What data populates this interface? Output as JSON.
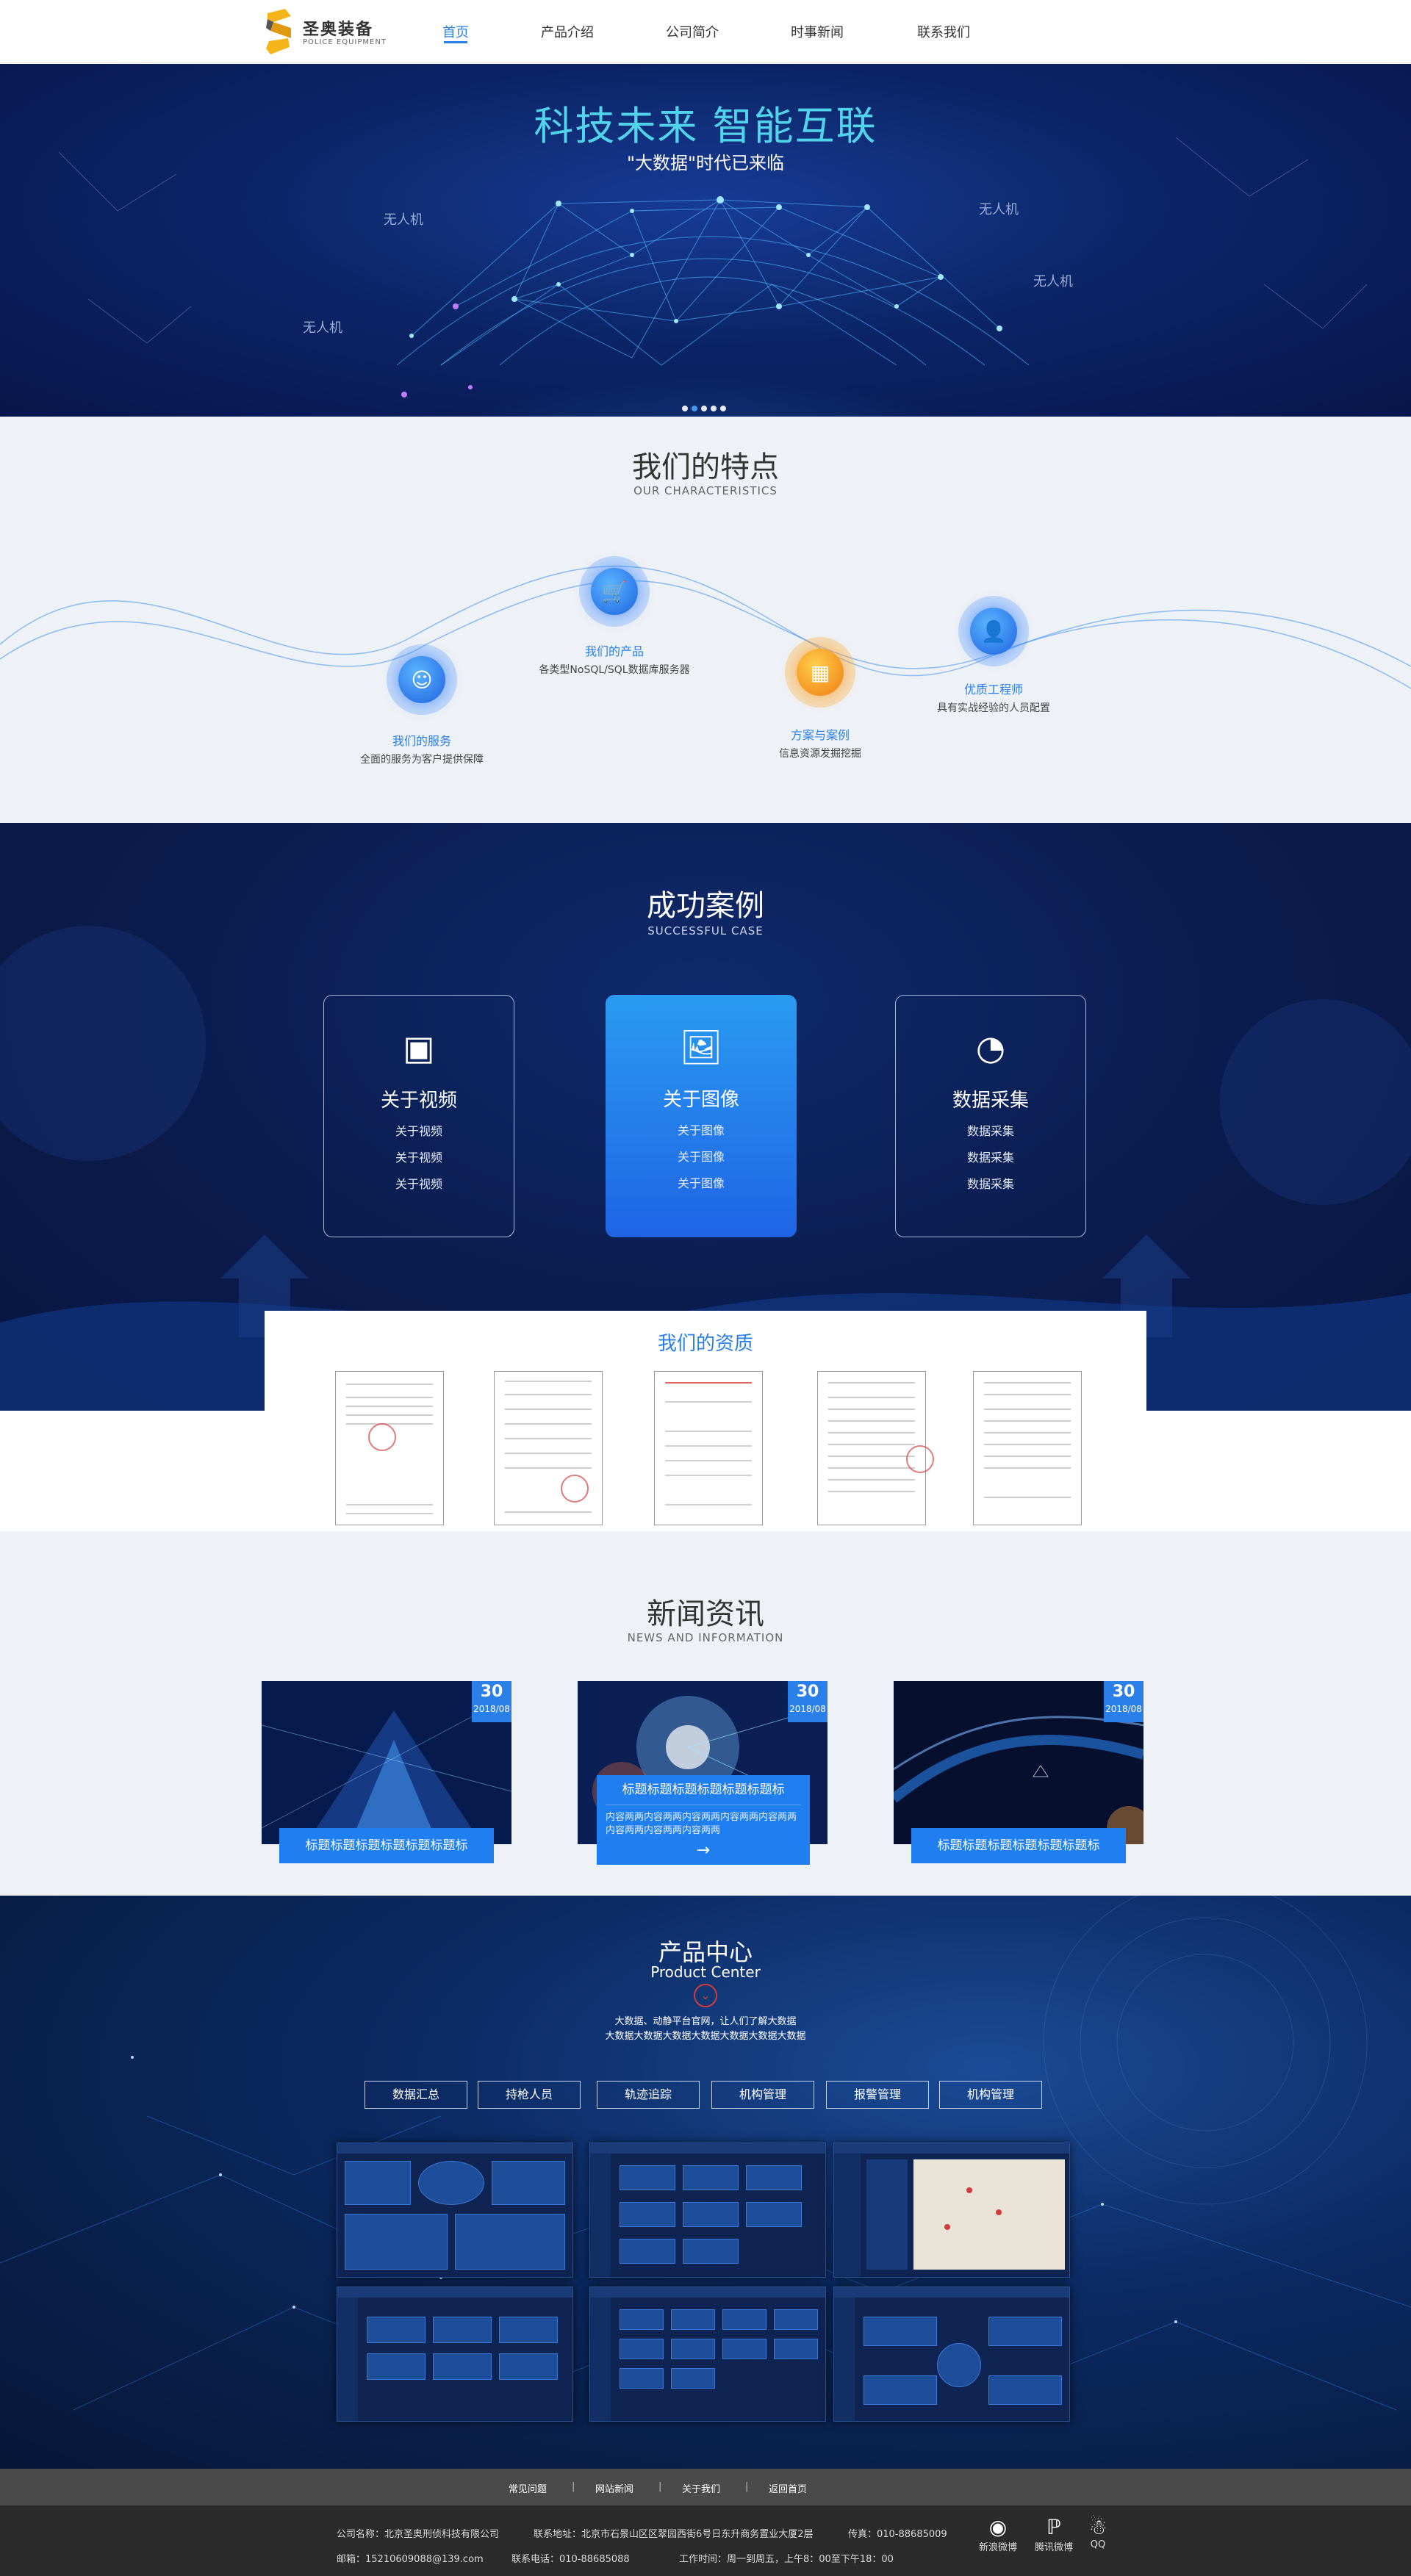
{
  "header": {
    "logo_name": "圣奥装备",
    "logo_sub": "POLICE EQUIPMENT",
    "nav": [
      "首页",
      "产品介绍",
      "公司简介",
      "时事新闻",
      "联系我们"
    ]
  },
  "hero": {
    "title": "科技未来 智能互联",
    "subtitle": "\"大数据\"时代已来临",
    "drone_label": "无人机"
  },
  "features": {
    "title": "我们的特点",
    "subtitle": "OUR CHARACTERISTICS",
    "items": [
      {
        "name": "我们的服务",
        "desc": "全面的服务为客户提供保障",
        "icon": "service-icon"
      },
      {
        "name": "我们的产品",
        "desc": "各类型NoSQL/SQL数据库服务器",
        "icon": "cart-icon"
      },
      {
        "name": "方案与案例",
        "desc": "信息资源发掘挖掘",
        "icon": "grid-icon"
      },
      {
        "name": "优质工程师",
        "desc": "具有实战经验的人员配置",
        "icon": "user-icon"
      }
    ]
  },
  "cases": {
    "title": "成功案例",
    "subtitle": "SUCCESSFUL CASE",
    "cards": [
      {
        "title": "关于视频",
        "lines": [
          "关于视频",
          "关于视频",
          "关于视频"
        ],
        "icon": "video-icon"
      },
      {
        "title": "关于图像",
        "lines": [
          "关于图像",
          "关于图像",
          "关于图像"
        ],
        "icon": "image-icon"
      },
      {
        "title": "数据采集",
        "lines": [
          "数据采集",
          "数据采集",
          "数据采集"
        ],
        "icon": "pie-chart-icon"
      }
    ]
  },
  "qualification": {
    "title": "我们的资质"
  },
  "news": {
    "title": "新闻资讯",
    "subtitle": "NEWS AND INFORMATION",
    "items": [
      {
        "day": "30",
        "month": "2018/08",
        "title": "标题标题标题标题标题标题标"
      },
      {
        "day": "30",
        "month": "2018/08",
        "title": "标题标题标题标题标题标题标",
        "desc": "内容两两内容两两内容两两内容两两内容两两内容两两内容两两内容两两",
        "arrow": "→"
      },
      {
        "day": "30",
        "month": "2018/08",
        "title": "标题标题标题标题标题标题标"
      }
    ]
  },
  "products": {
    "title": "产品中心",
    "subtitle": "Product Center",
    "desc_1": "大数据、动静平台官网，让人们了解大数据",
    "desc_2": "大数据大数据大数据大数据大数据大数据大数据",
    "tabs": [
      "数据汇总",
      "持枪人员",
      "轨迹追踪",
      "机构管理",
      "报警管理",
      "机构管理"
    ]
  },
  "footer": {
    "links": [
      "常见问题",
      "网站新闻",
      "关于我们",
      "返回首页"
    ],
    "company": "公司名称：北京圣奥刑侦科技有限公司",
    "address": "联系地址：北京市石景山区区翠园西街6号日东升商务置业大厦2层",
    "fax": "传真：010-88685009",
    "email": "邮箱：15210609088@139.com",
    "phone": "联系电话：010-88685088",
    "hours": "工作时间：周一到周五，上午8：00至下午18：00",
    "social": [
      {
        "label": "新浪微博",
        "icon": "weibo-icon"
      },
      {
        "label": "腾讯微博",
        "icon": "tencent-weibo-icon"
      },
      {
        "label": "QQ",
        "icon": "qq-icon"
      }
    ]
  },
  "colors": {
    "accent": "#2a7fe8",
    "hero_title": "#52d3ec",
    "orange": "#f07b12",
    "footer_bg": "#2b2b2b"
  }
}
